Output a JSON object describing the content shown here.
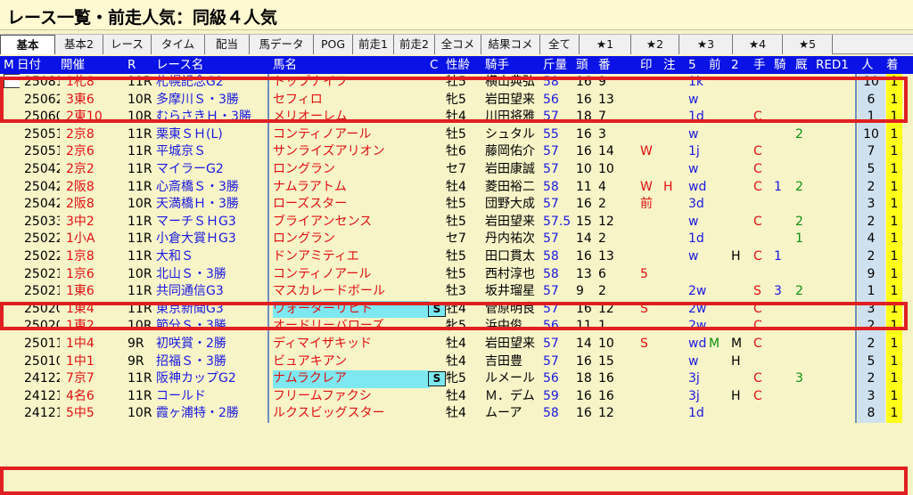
{
  "window": {
    "title": "レース一覧・前走人気：同級４人気"
  },
  "tabs": [
    "基本",
    "基本2",
    "レース",
    "タイム",
    "配当",
    "馬データ",
    "POG",
    "前走1",
    "前走2",
    "全コメ",
    "結果コメ",
    "全て",
    "★1",
    "★2",
    "★3",
    "★4",
    "★5"
  ],
  "header": {
    "m": "M",
    "date": "日付",
    "kaisai": "開催",
    "r": "R",
    "race": "レース名",
    "horse": "馬名",
    "c": "C",
    "sexage": "性齢",
    "jockey": "騎手",
    "kinryo": "斤量",
    "tosu": "頭",
    "uma": "番",
    "shirushi": "印",
    "chu": "注",
    "c5": "5",
    "mae": "前",
    "c2": "2",
    "te": "手",
    "ki": "騎",
    "kyu": "厩",
    "red1": "RED1",
    "ninki": "人",
    "chaku": "着"
  },
  "rows": [
    {
      "date": "250817",
      "kai": "1札8",
      "r": "11R",
      "race": "札幌記念G2",
      "horse": "トップナイフ",
      "sexage": "牡5",
      "jockey": "横山典弘",
      "kin": "58",
      "tosu": "16",
      "uma": "9",
      "m": "□",
      "five": "1k",
      "ninki": "10",
      "chaku": "1"
    },
    {
      "date": "250622",
      "kai": "3東6",
      "r": "10R",
      "race": "多摩川Ｓ・3勝",
      "horse": "セフィロ",
      "sexage": "牝5",
      "jockey": "岩田望来",
      "kin": "56",
      "tosu": "16",
      "uma": "13",
      "five": "w",
      "ninki": "6",
      "chaku": "1"
    },
    {
      "date": "250601",
      "kai": "2東10",
      "r": "10R",
      "race": "むらさきＨ・3勝",
      "horse": "メリオーレム",
      "sexage": "牡4",
      "jockey": "川田将雅",
      "kin": "57",
      "tosu": "18",
      "uma": "7",
      "five": "1d",
      "te": "C",
      "ninki": "1",
      "chaku": "1"
    },
    {
      "date": "250518",
      "kai": "2京8",
      "r": "11R",
      "race": "栗東ＳＨ(L)",
      "horse": "コンティノアール",
      "sexage": "牡5",
      "jockey": "シュタル",
      "kin": "55",
      "tosu": "16",
      "uma": "3",
      "five": "w",
      "red1": "2",
      "ninki": "10",
      "chaku": "1"
    },
    {
      "date": "250511",
      "kai": "2京6",
      "r": "11R",
      "race": "平城京Ｓ",
      "horse": "サンライズアリオン",
      "sexage": "牡6",
      "jockey": "藤岡佑介",
      "kin": "57",
      "tosu": "16",
      "uma": "14",
      "shirushi": "W",
      "five": "1j",
      "te": "C",
      "ninki": "7",
      "chaku": "1"
    },
    {
      "date": "250427",
      "kai": "2京2",
      "r": "11R",
      "race": "マイラーG2",
      "horse": "ロングラン",
      "sexage": "セ7",
      "jockey": "岩田康誠",
      "kin": "57",
      "tosu": "10",
      "uma": "10",
      "five": "w",
      "te": "C",
      "ninki": "5",
      "chaku": "1"
    },
    {
      "date": "250420",
      "kai": "2阪8",
      "r": "11R",
      "race": "心斎橋Ｓ・3勝",
      "horse": "ナムラアトム",
      "sexage": "牡4",
      "jockey": "菱田裕二",
      "kin": "58",
      "tosu": "11",
      "uma": "4",
      "shirushi": "W",
      "chu": "H",
      "five": "wd",
      "te": "C",
      "kyu": "1",
      "red1": "2",
      "ninki": "2",
      "chaku": "1"
    },
    {
      "date": "250420",
      "kai": "2阪8",
      "r": "10R",
      "race": "天満橋Ｈ・3勝",
      "horse": "ローズスター",
      "sexage": "牡5",
      "jockey": "団野大成",
      "kin": "57",
      "tosu": "16",
      "uma": "2",
      "shirushi": "前",
      "five": "3d",
      "ninki": "3",
      "chaku": "1"
    },
    {
      "date": "250330",
      "kai": "3中2",
      "r": "11R",
      "race": "マーチＳＨG3",
      "horse": "ブライアンセンス",
      "sexage": "牡5",
      "jockey": "岩田望来",
      "kin": "57.5",
      "tosu": "15",
      "uma": "12",
      "five": "w",
      "te": "C",
      "red1": "2",
      "ninki": "2",
      "chaku": "1"
    },
    {
      "date": "250223",
      "kai": "1小A",
      "r": "11R",
      "race": "小倉大賞ＨG3",
      "horse": "ロングラン",
      "sexage": "セ7",
      "jockey": "丹内祐次",
      "kin": "57",
      "tosu": "14",
      "uma": "2",
      "five": "1d",
      "red1": "1",
      "ninki": "4",
      "chaku": "1"
    },
    {
      "date": "250223",
      "kai": "1京8",
      "r": "11R",
      "race": "大和Ｓ",
      "horse": "ドンアミティエ",
      "sexage": "牡5",
      "jockey": "田口貫太",
      "kin": "58",
      "tosu": "16",
      "uma": "13",
      "five": "w",
      "nh": "H",
      "te": "C",
      "kyu": "1",
      "ninki": "2",
      "chaku": "1"
    },
    {
      "date": "250216",
      "kai": "1京6",
      "r": "10R",
      "race": "北山Ｓ・3勝",
      "horse": "コンティノアール",
      "sexage": "牡5",
      "jockey": "西村淳也",
      "kin": "58",
      "tosu": "13",
      "uma": "6",
      "shirushi": "5",
      "ninki": "9",
      "chaku": "1"
    },
    {
      "date": "250216",
      "kai": "1東6",
      "r": "11R",
      "race": "共同通信G3",
      "horse": "マスカレードボール",
      "sexage": "牡3",
      "jockey": "坂井瑠星",
      "kin": "57",
      "tosu": "9",
      "uma": "2",
      "five": "2w",
      "te": "S",
      "kyu": "3",
      "red1": "2",
      "ninki": "1",
      "chaku": "1"
    },
    {
      "date": "250209",
      "kai": "1東4",
      "r": "11R",
      "race": "東京新聞G3",
      "horse": "ウォーターリヒト",
      "badge": "S",
      "sexage": "牡4",
      "jockey": "菅原明良",
      "kin": "57",
      "tosu": "16",
      "uma": "12",
      "shirushi": "S",
      "five": "2w",
      "te": "C",
      "ninki": "3",
      "chaku": "1"
    },
    {
      "date": "250202",
      "kai": "1東2",
      "r": "10R",
      "race": "節分Ｓ・3勝",
      "horse": "オードリーバローズ",
      "sexage": "牝5",
      "jockey": "浜中俊",
      "kin": "56",
      "tosu": "11",
      "uma": "1",
      "five": "2w",
      "te": "C",
      "ninki": "2",
      "chaku": "1"
    },
    {
      "date": "250112",
      "kai": "1中4",
      "r": "9R",
      "race": "初咲賞・2勝",
      "horse": "ディマイザキッド",
      "sexage": "牡4",
      "jockey": "岩田望来",
      "kin": "57",
      "tosu": "14",
      "uma": "10",
      "shirushi": "S",
      "five": "wd",
      "m2": "M",
      "nm": "M",
      "te": "C",
      "ninki": "2",
      "chaku": "1"
    },
    {
      "date": "250105",
      "kai": "1中1",
      "r": "9R",
      "race": "招福Ｓ・3勝",
      "horse": "ビュアキアン",
      "sexage": "牡4",
      "jockey": "吉田豊",
      "kin": "57",
      "tosu": "16",
      "uma": "15",
      "five": "w",
      "nh": "H",
      "ninki": "5",
      "chaku": "1"
    },
    {
      "date": "241221",
      "kai": "7京7",
      "r": "11R",
      "race": "阪神カップG2",
      "horse": "ナムラクレア",
      "badge": "S",
      "sexage": "牝5",
      "jockey": "ルメール",
      "kin": "56",
      "tosu": "18",
      "uma": "16",
      "five": "3j",
      "te": "C",
      "red1": "3",
      "ninki": "2",
      "chaku": "1"
    },
    {
      "date": "241215",
      "kai": "4名6",
      "r": "11R",
      "race": "コールド",
      "horse": "フリームファクシ",
      "sexage": "牡4",
      "jockey": "Ｍ．デム",
      "kin": "59",
      "tosu": "16",
      "uma": "16",
      "five": "3j",
      "nh": "H",
      "te": "C",
      "ninki": "3",
      "chaku": "1"
    },
    {
      "date": "241214",
      "kai": "5中5",
      "r": "10R",
      "race": "霞ヶ浦特・2勝",
      "horse": "ルクスビッグスター",
      "sexage": "牡4",
      "jockey": "ムーア",
      "kin": "58",
      "tosu": "16",
      "uma": "12",
      "five": "1d",
      "ninki": "8",
      "chaku": "1"
    }
  ],
  "colors": {
    "header_bg": "#0a12e6",
    "row_bg": "#f7f4c8",
    "highlight": "#e02020",
    "chaku_bg": "#ffff1a",
    "text_blue": "#1a1adf",
    "text_red": "#e01010",
    "text_green": "#0d8f0d"
  }
}
